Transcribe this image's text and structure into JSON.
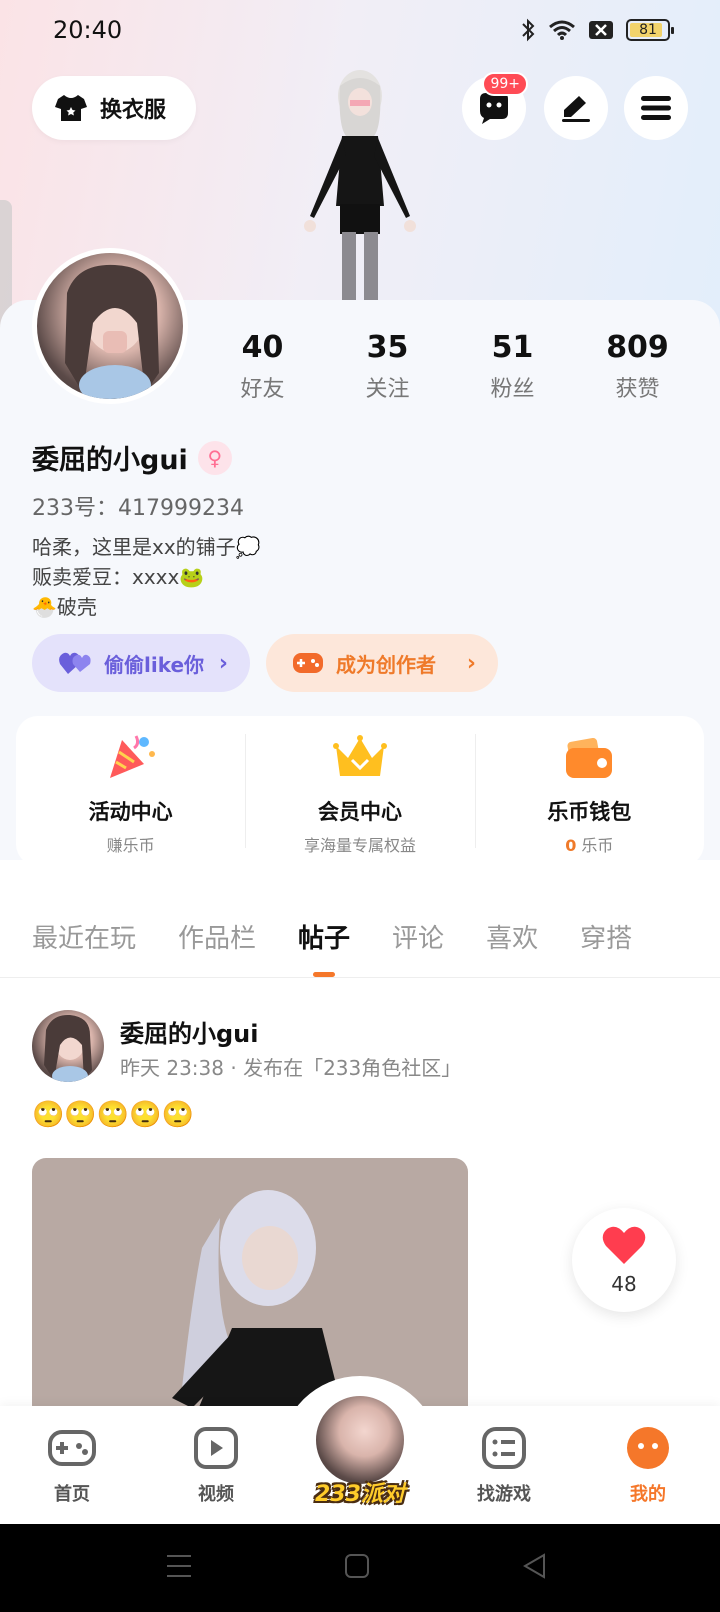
{
  "status_bar": {
    "time": "20:40",
    "battery": "81"
  },
  "header": {
    "outfit_button": "换衣服",
    "messages_badge": "99+",
    "icons": [
      "tshirt-icon",
      "chat-bubble-icon",
      "edit-icon",
      "menu-icon"
    ]
  },
  "profile": {
    "username": "委屈的小gui",
    "gender_icon": "female-icon",
    "uid": "233号：417999234",
    "bio": "哈柔，这里是xx的铺子💭\n贩卖爱豆：xxxx🐸\n🐣破壳",
    "stats": [
      {
        "num": "40",
        "label": "好友"
      },
      {
        "num": "35",
        "label": "关注"
      },
      {
        "num": "51",
        "label": "粉丝"
      },
      {
        "num": "809",
        "label": "获赞"
      }
    ],
    "like_pill": "偷偷like你",
    "creator_pill": "成为创作者"
  },
  "quick_cards": [
    {
      "title": "活动中心",
      "sub": "赚乐币",
      "icon": "party-popper-icon"
    },
    {
      "title": "会员中心",
      "sub": "享海量专属权益",
      "icon": "crown-icon"
    },
    {
      "title": "乐币钱包",
      "sub_value": "0",
      "sub_unit": "乐币",
      "icon": "wallet-icon"
    }
  ],
  "tabs": [
    "最近在玩",
    "作品栏",
    "帖子",
    "评论",
    "喜欢",
    "穿搭"
  ],
  "active_tab": "帖子",
  "post": {
    "author": "委屈的小gui",
    "meta": "昨天 23:38 · 发布在「233角色社区」",
    "text": "🙄🙄🙄🙄🙄",
    "likes": "48"
  },
  "bottom_nav": {
    "items": [
      {
        "label": "首页",
        "icon": "gamepad-icon"
      },
      {
        "label": "视频",
        "icon": "play-icon"
      },
      {
        "label": "233派对",
        "icon": "avatar-center"
      },
      {
        "label": "找游戏",
        "icon": "list-icon"
      },
      {
        "label": "我的",
        "icon": "face-icon"
      }
    ],
    "active": "我的"
  },
  "colors": {
    "accent": "#f5772a",
    "like_purple": "#6a5fdb",
    "heart": "#ff3d4f"
  }
}
